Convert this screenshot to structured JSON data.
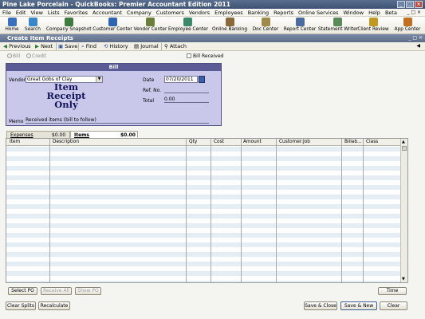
{
  "window": {
    "company": "Pine Lake Porcelain",
    "app_title": "QuickBooks: Premier Accountant Edition 2011"
  },
  "menu": [
    "File",
    "Edit",
    "View",
    "Lists",
    "Favorites",
    "Accountant",
    "Company",
    "Customers",
    "Vendors",
    "Employees",
    "Banking",
    "Reports",
    "Online Services",
    "Window",
    "Help",
    "Beta"
  ],
  "iconbar": [
    {
      "label": "Home",
      "icon": "home-icon",
      "color": "#3a6fc0"
    },
    {
      "label": "Search",
      "icon": "search-icon",
      "color": "#3a86c8"
    },
    {
      "label": "Company Snapshot",
      "icon": "snapshot-icon",
      "color": "#3f7a3f"
    },
    {
      "label": "Customer Center",
      "icon": "customer-icon",
      "color": "#2f64b0"
    },
    {
      "label": "Vendor Center",
      "icon": "vendor-icon",
      "color": "#6a7f3a"
    },
    {
      "label": "Employee Center",
      "icon": "employee-icon",
      "color": "#3a8a6a"
    },
    {
      "label": "Online Banking",
      "icon": "bank-icon",
      "color": "#8a6a3a"
    },
    {
      "label": "Doc Center",
      "icon": "doc-icon",
      "color": "#a08a4a"
    },
    {
      "label": "Report Center",
      "icon": "report-icon",
      "color": "#4a6aa0"
    },
    {
      "label": "Statement Writer",
      "icon": "statement-icon",
      "color": "#5a8a5a"
    },
    {
      "label": "Client Review",
      "icon": "review-icon",
      "color": "#c09a20"
    },
    {
      "label": "App Center",
      "icon": "app-icon",
      "color": "#c07020"
    }
  ],
  "subwindow": {
    "title": "Create Item Receipts"
  },
  "toolbar": {
    "previous": "Previous",
    "next": "Next",
    "save": "Save",
    "find": "Find",
    "history": "History",
    "journal": "Journal",
    "attach": "Attach"
  },
  "options": {
    "bill": "Bill",
    "credit": "Credit",
    "bill_received": "Bill Received"
  },
  "form": {
    "header": "Bill",
    "vendor_label": "Vendor",
    "vendor_value": "Great Gobs of Clay",
    "date_label": "Date",
    "date_value": "07/20/2011",
    "ref_label": "Ref. No.",
    "total_label": "Total",
    "total_value": "0.00",
    "stamp_line1": "Item",
    "stamp_line2": "Receipt",
    "stamp_line3": "Only",
    "memo_label": "Memo",
    "memo_value": "Received items (bill to follow)"
  },
  "tabs": [
    {
      "label": "Expenses",
      "amount": "$0.00"
    },
    {
      "label": "Items",
      "amount": "$0.00"
    }
  ],
  "grid": {
    "columns": [
      "Item",
      "Description",
      "Qty",
      "Cost",
      "Amount",
      "Customer:Job",
      "Billab...",
      "Class"
    ]
  },
  "buttons": {
    "select_po": "Select PO",
    "receive_all": "Receive All",
    "show_po": "Show PO",
    "time": "Time",
    "clear_splits": "Clear Splits",
    "recalculate": "Recalculate",
    "save_close": "Save & Close",
    "save_new": "Save & New",
    "clear": "Clear"
  }
}
